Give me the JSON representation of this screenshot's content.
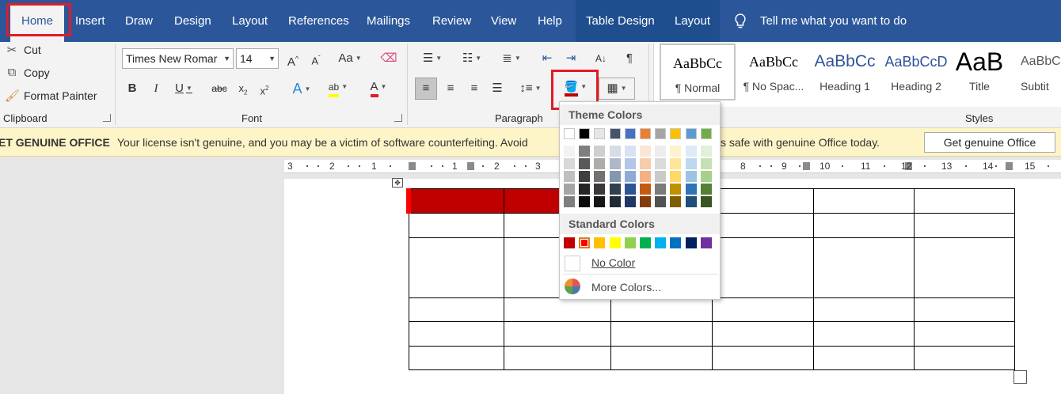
{
  "tabs": [
    "Home",
    "Insert",
    "Draw",
    "Design",
    "Layout",
    "References",
    "Mailings",
    "Review",
    "View",
    "Help"
  ],
  "context_tabs": [
    "Table Design",
    "Layout"
  ],
  "tell_me": "Tell me what you want to do",
  "clipboard": {
    "cut": "Cut",
    "copy": "Copy",
    "format_painter": "Format Painter",
    "label": "Clipboard"
  },
  "font": {
    "name": "Times New Romar",
    "size": "14",
    "label": "Font"
  },
  "paragraph": {
    "label": "Paragraph"
  },
  "styles": {
    "label": "Styles",
    "items": [
      {
        "sample": "AaBbCc",
        "name": "¶ Normal"
      },
      {
        "sample": "AaBbCc",
        "name": "¶ No Spac..."
      },
      {
        "sample": "AaBbCc",
        "name": "Heading 1"
      },
      {
        "sample": "AaBbCcD",
        "name": "Heading 2"
      },
      {
        "sample": "AaB",
        "name": "Title"
      },
      {
        "sample": "AaBbC",
        "name": "Subtit"
      }
    ]
  },
  "license": {
    "title": "ET GENUINE OFFICE",
    "message": "Your license isn't genuine, and you may be a victim of software counterfeiting. Avoid",
    "message_tail": "s safe with genuine Office today.",
    "button": "Get genuine Office"
  },
  "ruler_numbers": [
    "3",
    "2",
    "1",
    "1",
    "2",
    "3",
    "8",
    "9",
    "10",
    "11",
    "12",
    "13",
    "14",
    "15"
  ],
  "shading_menu": {
    "theme_label": "Theme Colors",
    "standard_label": "Standard Colors",
    "no_color": "No Color",
    "more_colors": "More Colors...",
    "theme_colors": [
      [
        "#ffffff",
        "#000000",
        "#e7e6e6",
        "#44546a",
        "#4472c4",
        "#ed7d31",
        "#a5a5a5",
        "#ffc000",
        "#5b9bd5",
        "#70ad47"
      ],
      [
        "#f2f2f2",
        "#7f7f7f",
        "#d0cece",
        "#d6dce4",
        "#d9e2f3",
        "#fbe5d5",
        "#ededed",
        "#fff2cc",
        "#ddebf7",
        "#e2efd9"
      ],
      [
        "#d8d8d8",
        "#595959",
        "#aeabab",
        "#adb9ca",
        "#b4c6e7",
        "#f7cbac",
        "#dbdbdb",
        "#fee599",
        "#bdd7ee",
        "#c5e0b3"
      ],
      [
        "#bfbfbf",
        "#3f3f3f",
        "#757070",
        "#8496b0",
        "#8eaadb",
        "#f4b183",
        "#c9c9c9",
        "#ffd965",
        "#9cc3e5",
        "#a8d08d"
      ],
      [
        "#a5a5a5",
        "#262626",
        "#3a3838",
        "#323f4f",
        "#2f5496",
        "#c55a11",
        "#7b7b7b",
        "#bf9000",
        "#2e75b5",
        "#538135"
      ],
      [
        "#7f7f7f",
        "#0c0c0c",
        "#171616",
        "#222a35",
        "#1f3864",
        "#833c0b",
        "#525252",
        "#7f6000",
        "#1e4e79",
        "#375623"
      ]
    ],
    "standard_colors": [
      "#c00000",
      "#ff0000",
      "#ffc000",
      "#ffff00",
      "#92d050",
      "#00b050",
      "#00b0f0",
      "#0070c0",
      "#002060",
      "#7030a0"
    ]
  },
  "colors": {
    "tab_bar": "#2b579a",
    "accent_red": "#e21b25",
    "table_header_fill": "#c00000"
  }
}
